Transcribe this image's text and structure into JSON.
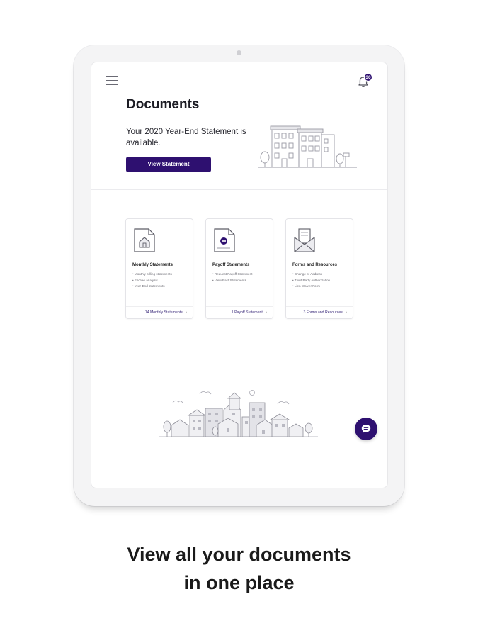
{
  "header": {
    "page_title": "Documents",
    "notification_count": "30",
    "promo_text": "Your 2020 Year-End Statement is available.",
    "promo_button": "View Statement"
  },
  "cards": [
    {
      "title": "Monthly Statements",
      "icon": "house-document-icon",
      "lines": [
        "• Monthly billing statements",
        "• Escrow analysis",
        "• Year-End statements"
      ],
      "footer": "14 Monthly Statements"
    },
    {
      "title": "Payoff Statements",
      "icon": "payoff-document-icon",
      "lines": [
        "• Request Payoff Statement",
        "• View Past Statements"
      ],
      "footer": "1 Payoff Statement"
    },
    {
      "title": "Forms and Resources",
      "icon": "envelope-document-icon",
      "lines": [
        "• Change of Address",
        "• Third Party Authorization",
        "• Lien Waiver Form"
      ],
      "footer": "3 Forms and Resources"
    }
  ],
  "caption": {
    "line1": "View all your documents",
    "line2": "in one place"
  },
  "colors": {
    "accent": "#2e1070",
    "text": "#1c1c24",
    "muted": "#6b6b73"
  },
  "icons": [
    "menu-icon",
    "bell-icon",
    "chat-icon",
    "chevron-right-icon"
  ]
}
